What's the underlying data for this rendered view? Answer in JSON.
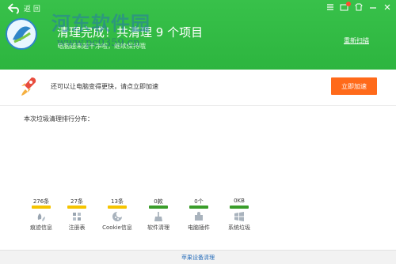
{
  "window": {
    "back_label": "返 回"
  },
  "watermark": {
    "brand": "河东软件园",
    "url": "www.pc0359.cn"
  },
  "header": {
    "headline": "清理完成！共清理 9 个项目",
    "subline": "电脑越来越干净啦，继续保持哦",
    "recheck_label": "重新扫描"
  },
  "tip": {
    "text": "还可以让电脑变得更快，请点立即加速",
    "button_label": "立即加速"
  },
  "distribution": {
    "title": "本次垃圾清理排行分布：",
    "items": [
      {
        "count": "276条",
        "label": "痕迹信息",
        "color": "#f5c400",
        "icon": "trace-icon"
      },
      {
        "count": "27条",
        "label": "注册表",
        "color": "#f5c400",
        "icon": "registry-icon"
      },
      {
        "count": "13条",
        "label": "Cookie信息",
        "color": "#f5c400",
        "icon": "cookie-icon"
      },
      {
        "count": "0款",
        "label": "软件清理",
        "color": "#3a9d2a",
        "icon": "broom-icon"
      },
      {
        "count": "0个",
        "label": "电脑插件",
        "color": "#3a9d2a",
        "icon": "plugin-icon"
      },
      {
        "count": "0KB",
        "label": "系统垃圾",
        "color": "#3a9d2a",
        "icon": "windows-icon"
      }
    ]
  },
  "footer": {
    "link_label": "苹果设备清理"
  },
  "colors": {
    "header_green": "#2db53f",
    "accent_orange": "#ff6a1a",
    "link_blue": "#2a6fbb"
  }
}
